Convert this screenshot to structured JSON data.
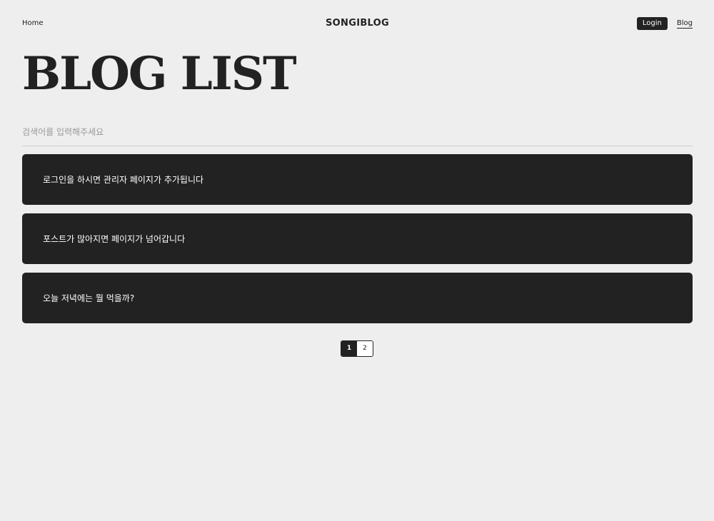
{
  "nav": {
    "home_label": "Home",
    "brand": "SONGIBLOG",
    "login_label": "Login",
    "blog_label": "Blog"
  },
  "page_title": "BLOG LIST",
  "search": {
    "placeholder": "검색어를 입력해주세요",
    "value": ""
  },
  "posts": [
    {
      "title": "로그인을 하시면 관리자 페이지가 추가됩니다"
    },
    {
      "title": "포스트가 많아지면 페이지가 넘어갑니다"
    },
    {
      "title": "오늘 저녁에는 뭘 먹을까?"
    }
  ],
  "pagination": {
    "pages": [
      "1",
      "2"
    ],
    "current": "1"
  },
  "colors": {
    "background": "#eeeeee",
    "card": "#222222",
    "accent": "#222222"
  }
}
